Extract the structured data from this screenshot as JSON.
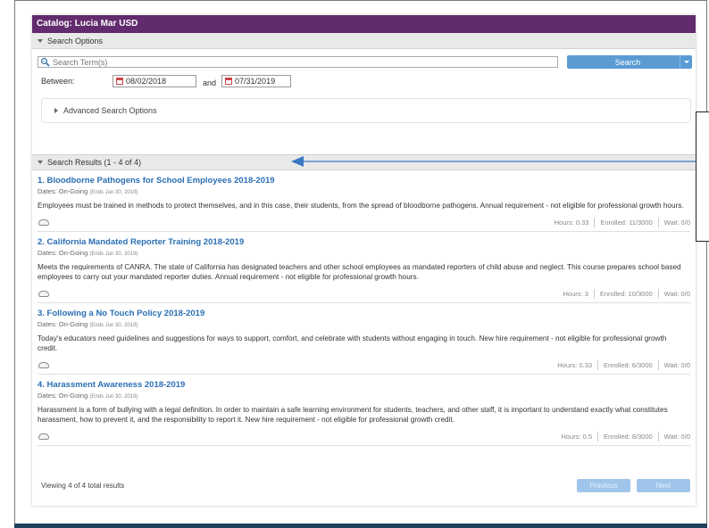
{
  "catalog": {
    "title": "Catalog: Lucia Mar USD"
  },
  "search_options": {
    "header": "Search Options",
    "placeholder": "Search Term(s)",
    "search_button": "Search",
    "between_label": "Between:",
    "start_date": "08/02/2018",
    "and_label": "and",
    "end_date": "07/31/2019",
    "advanced": "Advanced Search Options"
  },
  "results": {
    "header": "Search Results (1 - 4 of 4)",
    "items": [
      {
        "title": "1. Bloodborne Pathogens for School Employees 2018-2019",
        "dates_label": "Dates: On-Going",
        "ends": "(Ends Jun 30, 2019)",
        "description": "Employees must be trained in methods to protect themselves, and in this case, their students, from the spread of bloodborne pathogens. Annual requirement - not eligible for professional growth hours.",
        "hours": "Hours: 0.33",
        "enrolled": "Enrolled: 11/3000",
        "wait": "Wait: 0/0"
      },
      {
        "title": "2. California Mandated Reporter Training 2018-2019",
        "dates_label": "Dates: On-Going",
        "ends": "(Ends Jun 30, 2019)",
        "description": "Meets the requirements of CANRA. The state of California has designated teachers and other school employees as mandated reporters of child abuse and neglect. This course prepares school based employees to carry out your mandated reporter duties. Annual requirement - not eligible for professional growth hours.",
        "hours": "Hours: 3",
        "enrolled": "Enrolled: 10/3000",
        "wait": "Wait: 0/0"
      },
      {
        "title": "3. Following a No Touch Policy 2018-2019",
        "dates_label": "Dates: On-Going",
        "ends": "(Ends Jun 30, 2019)",
        "description": "Today's educators need guidelines and suggestions for ways to support, comfort, and celebrate with students without engaging in touch. New hire requirement - not eligible for professional growth credit.",
        "hours": "Hours: 0.33",
        "enrolled": "Enrolled: 6/3000",
        "wait": "Wait: 0/0"
      },
      {
        "title": "4. Harassment Awareness 2018-2019",
        "dates_label": "Dates: On-Going",
        "ends": "(Ends Jun 30, 2019)",
        "description": "Harassment is a form of bullying with a legal definition. In order to maintain a safe learning environment for students, teachers, and other staff, it is important to understand exactly what constitutes harassment, how to prevent it, and the responsibility to report it. New hire requirement - not eligible for professional growth credit.",
        "hours": "Hours: 0.5",
        "enrolled": "Enrolled: 8/3000",
        "wait": "Wait: 0/0"
      }
    ]
  },
  "pager": {
    "summary": "Viewing 4 of 4 total results",
    "previous": "Previous",
    "next": "Next"
  },
  "colors": {
    "header_purple": "#622b6d",
    "link_blue": "#2a6fb5",
    "button_blue": "#5a9bd4"
  }
}
